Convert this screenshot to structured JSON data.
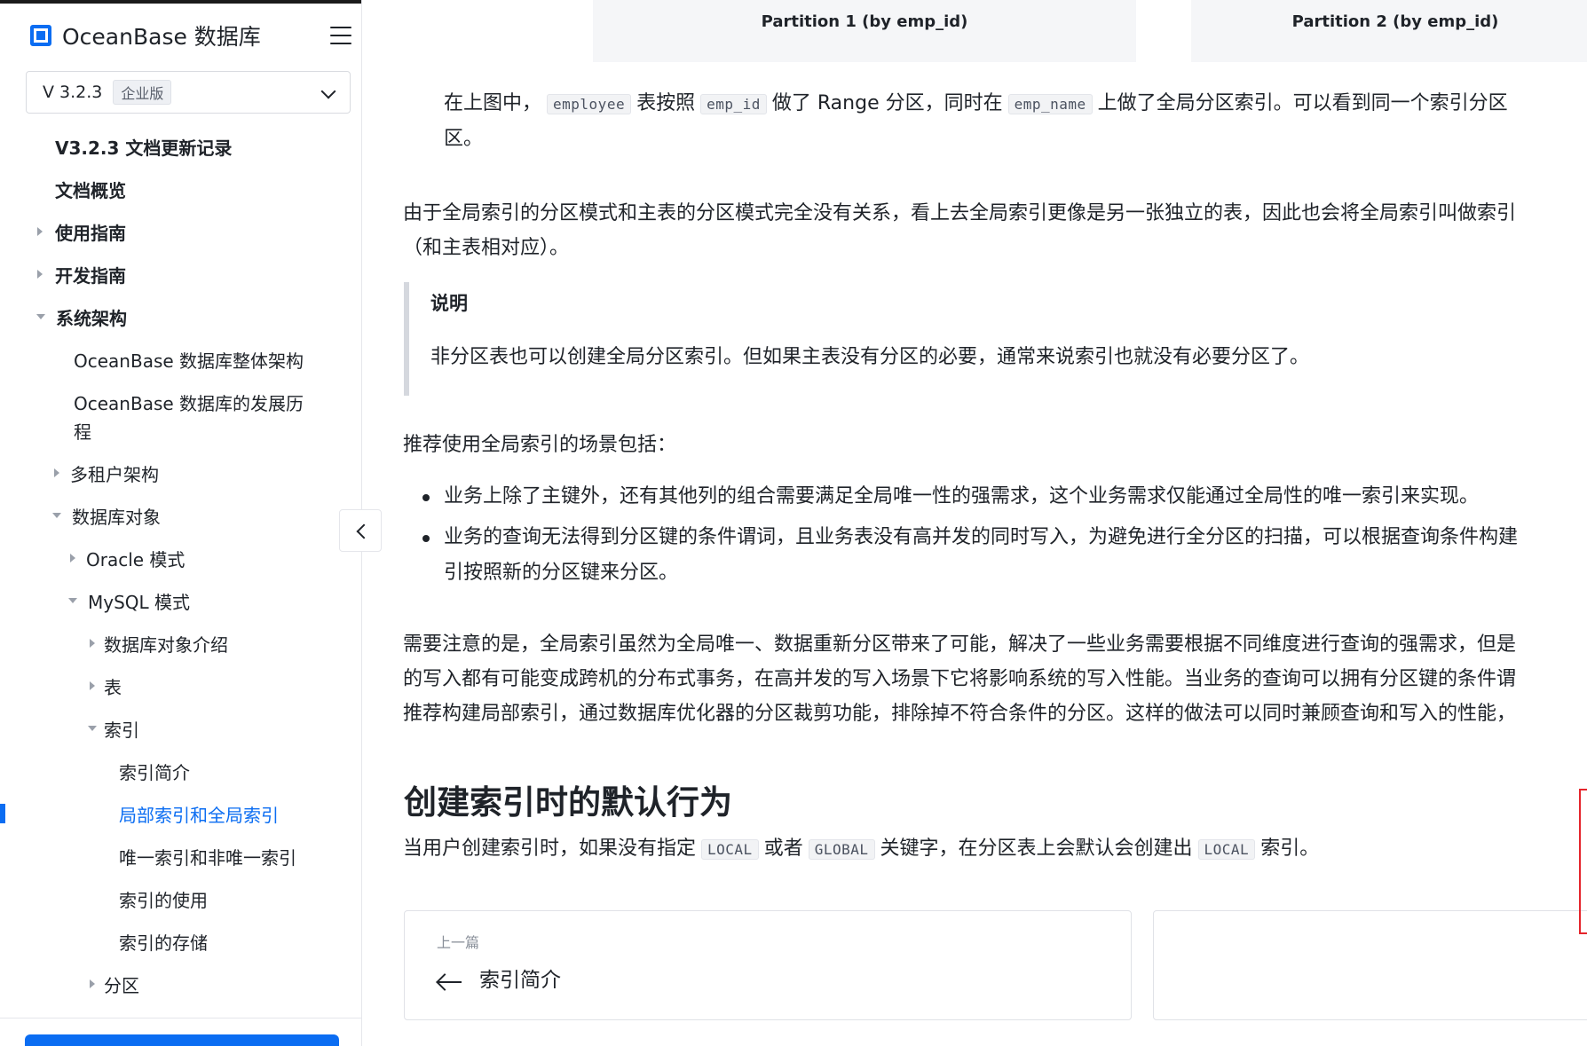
{
  "sidebar": {
    "logo_text": "OceanBase 数据库",
    "version": {
      "value": "V 3.2.3",
      "edition": "企业版"
    },
    "tree": [
      {
        "label": "V3.2.3 文档更新记录"
      },
      {
        "label": "文档概览"
      },
      {
        "label": "使用指南"
      },
      {
        "label": "开发指南"
      },
      {
        "label": "系统架构"
      },
      {
        "label": "OceanBase 数据库整体架构"
      },
      {
        "label": "OceanBase 数据库的发展历"
      },
      {
        "label": "程"
      },
      {
        "label": "多租户架构"
      },
      {
        "label": "数据库对象"
      },
      {
        "label": "Oracle 模式"
      },
      {
        "label": "MySQL 模式"
      },
      {
        "label": "数据库对象介绍"
      },
      {
        "label": "表"
      },
      {
        "label": "索引"
      },
      {
        "label": "索引简介"
      },
      {
        "label": "局部索引和全局索引"
      },
      {
        "label": "唯一索引和非唯一索引"
      },
      {
        "label": "索引的使用"
      },
      {
        "label": "索引的存储"
      },
      {
        "label": "分区"
      }
    ],
    "accent_color": "#0b6df2"
  },
  "figure": {
    "partition1": "Partition 1 (by emp_id)",
    "partition2": "Partition 2 (by emp_id)"
  },
  "article": {
    "p1": {
      "a": "在上图中，",
      "code1": "employee",
      "b": "表按照",
      "code2": "emp_id",
      "c": "做了 Range 分区，同时在",
      "code3": "emp_name",
      "d": "上做了全局分区索引。可以看到同一个索引分区",
      "e": "区。"
    },
    "p2": {
      "line1": "由于全局索引的分区模式和主表的分区模式完全没有关系，看上去全局索引更像是另一张独立的表，因此也会将全局索引叫做索引",
      "line2": "（和主表相对应）。"
    },
    "note": {
      "title": "说明",
      "body": "非分区表也可以创建全局分区索引。但如果主表没有分区的必要，通常来说索引也就没有必要分区了。"
    },
    "scenarios_intro": "推荐使用全局索引的场景包括：",
    "scenarios": [
      "业务上除了主键外，还有其他列的组合需要满足全局唯一性的强需求，这个业务需求仅能通过全局性的唯一索引来实现。",
      "业务的查询无法得到分区键的条件谓词，且业务表没有高并发的同时写入，为避免进行全分区的扫描，可以根据查询条件构建",
      "引按照新的分区键来分区。"
    ],
    "p3": {
      "line1": "需要注意的是，全局索引虽然为全局唯一、数据重新分区带来了可能，解决了一些业务需要根据不同维度进行查询的强需求，但是",
      "line2": "的写入都有可能变成跨机的分布式事务，在高并发的写入场景下它将影响系统的写入性能。当业务的查询可以拥有分区键的条件谓",
      "line3": "推荐构建局部索引，通过数据库优化器的分区裁剪功能，排除掉不符合条件的分区。这样的做法可以同时兼顾查询和写入的性能，"
    },
    "section_title": "创建索引时的默认行为",
    "p4": {
      "a": "当用户创建索引时，如果没有指定",
      "code1": "LOCAL",
      "b": "或者",
      "code2": "GLOBAL",
      "c": "关键字，在分区表上会默认会创建出",
      "code3": "LOCAL",
      "d": "索引。"
    }
  },
  "nav": {
    "prev_label": "上一篇",
    "prev_title": "索引简介"
  },
  "colors": {
    "annotation_red": "#e5242b",
    "link_blue": "#0b6df2"
  }
}
